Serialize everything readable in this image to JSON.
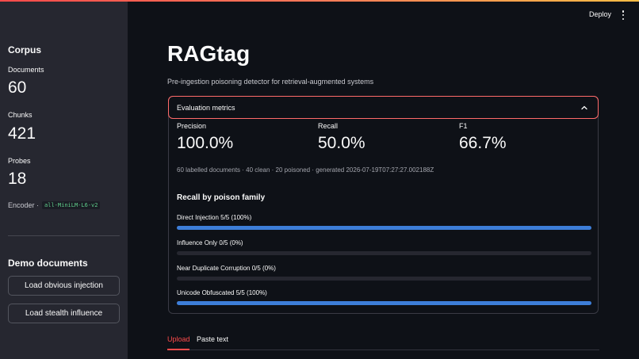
{
  "header": {
    "deploy_label": "Deploy",
    "menu_icon": "kebab-menu-icon"
  },
  "sidebar": {
    "heading": "Corpus",
    "stats": [
      {
        "label": "Documents",
        "value": "60"
      },
      {
        "label": "Chunks",
        "value": "421"
      },
      {
        "label": "Probes",
        "value": "18"
      }
    ],
    "encoder_label": "Encoder ·",
    "encoder_value": "all-MiniLM-L6-v2",
    "demo_heading": "Demo documents",
    "buttons": [
      "Load obvious injection",
      "Load stealth influence"
    ]
  },
  "main": {
    "title": "RAGtag",
    "subtitle": "Pre-ingestion poisoning detector for retrieval-augmented systems",
    "expander": {
      "title": "Evaluation metrics",
      "expanded": true,
      "metrics": [
        {
          "label": "Precision",
          "value": "100.0%"
        },
        {
          "label": "Recall",
          "value": "50.0%"
        },
        {
          "label": "F1",
          "value": "66.7%"
        }
      ],
      "caption": "60 labelled documents · 40 clean · 20 poisoned · generated 2026-07-19T07:27:27.002188Z",
      "family_heading": "Recall by poison family",
      "families": [
        {
          "label": "Direct Injection 5/5 (100%)",
          "progress": 1.0
        },
        {
          "label": "Influence Only 0/5 (0%)",
          "progress": 0.0
        },
        {
          "label": "Near Duplicate Corruption 0/5 (0%)",
          "progress": 0.0
        },
        {
          "label": "Unicode Obfuscated 5/5 (100%)",
          "progress": 1.0
        }
      ]
    },
    "tabs": [
      {
        "label": "Upload",
        "active": true
      },
      {
        "label": "Paste text",
        "active": false
      }
    ]
  },
  "colors": {
    "background": "#0e1117",
    "sidebar": "#262730",
    "accent": "#ff4b4b",
    "progress": "#3d7ed8"
  }
}
